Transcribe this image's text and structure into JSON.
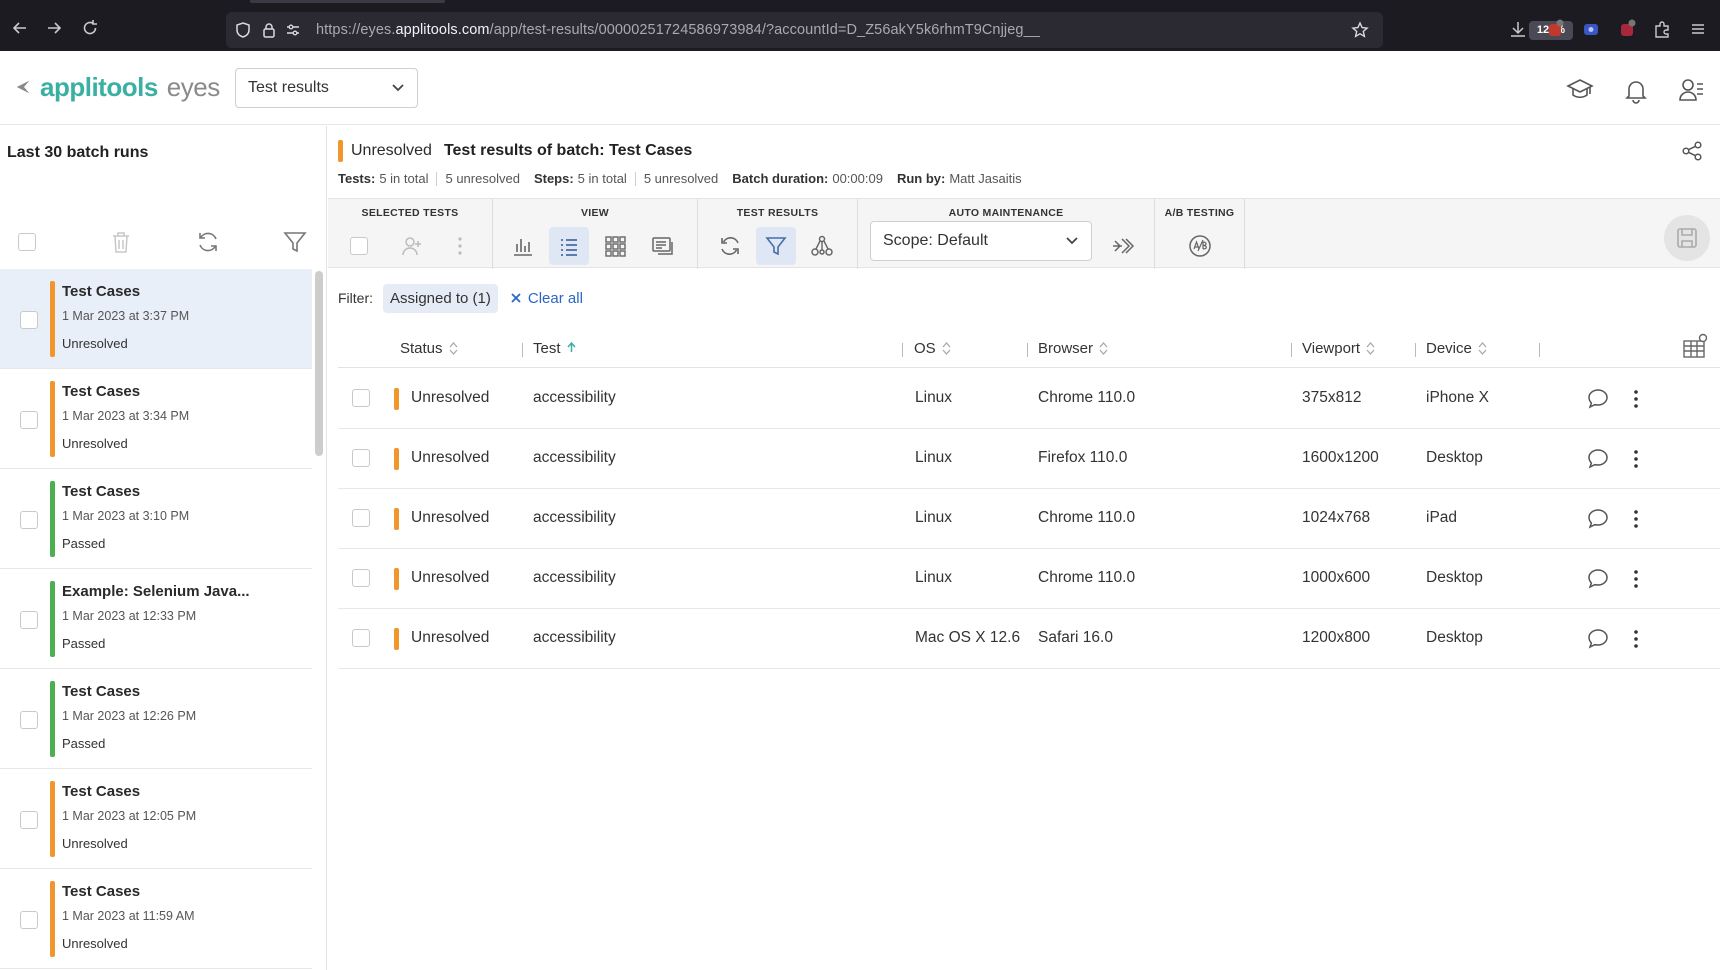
{
  "browser": {
    "url_prefix": "https://eyes.",
    "url_domain": "applitools.com",
    "url_path": "/app/test-results/00000251724586973984/?accountId=D_Z56akY5k6rhmT9Cnjjeg__",
    "zoom": "120%"
  },
  "header": {
    "logo_brand": "applitools",
    "logo_product": "eyes",
    "view_select": "Test results"
  },
  "sidebar": {
    "title": "Last 30 batch runs",
    "status_colors": {
      "Unresolved": "#f0962c",
      "Passed": "#4caf50"
    },
    "batches": [
      {
        "name": "Test Cases",
        "date": "1 Mar 2023 at 3:37 PM",
        "status": "Unresolved",
        "color": "#f0962c"
      },
      {
        "name": "Test Cases",
        "date": "1 Mar 2023 at 3:34 PM",
        "status": "Unresolved",
        "color": "#f0962c"
      },
      {
        "name": "Test Cases",
        "date": "1 Mar 2023 at 3:10 PM",
        "status": "Passed",
        "color": "#4caf50"
      },
      {
        "name": "Example: Selenium Java...",
        "date": "1 Mar 2023 at 12:33 PM",
        "status": "Passed",
        "color": "#4caf50"
      },
      {
        "name": "Test Cases",
        "date": "1 Mar 2023 at 12:26 PM",
        "status": "Passed",
        "color": "#4caf50"
      },
      {
        "name": "Test Cases",
        "date": "1 Mar 2023 at 12:05 PM",
        "status": "Unresolved",
        "color": "#f0962c"
      },
      {
        "name": "Test Cases",
        "date": "1 Mar 2023 at 11:59 AM",
        "status": "Unresolved",
        "color": "#f0962c"
      }
    ]
  },
  "batch": {
    "status": "Unresolved",
    "title_label": "Test results of batch:",
    "name": "Test Cases",
    "tests_label": "Tests:",
    "tests_total": "5 in total",
    "tests_unresolved": "5 unresolved",
    "steps_label": "Steps:",
    "steps_total": "5 in total",
    "steps_unresolved": "5 unresolved",
    "duration_label": "Batch duration:",
    "duration": "00:00:09",
    "runby_label": "Run by:",
    "runby": "Matt Jasaitis"
  },
  "toolbar": {
    "selected_tests": "SELECTED TESTS",
    "view": "VIEW",
    "test_results": "TEST RESULTS",
    "auto_maintenance": "AUTO MAINTENANCE",
    "ab_testing": "A/B TESTING",
    "scope": "Scope: Default"
  },
  "filter": {
    "label": "Filter:",
    "chip": "Assigned to (1)",
    "clear": "Clear all"
  },
  "table": {
    "columns": {
      "status": "Status",
      "test": "Test",
      "os": "OS",
      "browser": "Browser",
      "viewport": "Viewport",
      "device": "Device"
    },
    "rows": [
      {
        "status": "Unresolved",
        "test": "accessibility",
        "os": "Linux",
        "browser": "Chrome 110.0",
        "viewport": "375x812",
        "device": "iPhone X"
      },
      {
        "status": "Unresolved",
        "test": "accessibility",
        "os": "Linux",
        "browser": "Firefox 110.0",
        "viewport": "1600x1200",
        "device": "Desktop"
      },
      {
        "status": "Unresolved",
        "test": "accessibility",
        "os": "Linux",
        "browser": "Chrome 110.0",
        "viewport": "1024x768",
        "device": "iPad"
      },
      {
        "status": "Unresolved",
        "test": "accessibility",
        "os": "Linux",
        "browser": "Chrome 110.0",
        "viewport": "1000x600",
        "device": "Desktop"
      },
      {
        "status": "Unresolved",
        "test": "accessibility",
        "os": "Mac OS X 12.6",
        "browser": "Safari 16.0",
        "viewport": "1200x800",
        "device": "Desktop"
      }
    ]
  }
}
